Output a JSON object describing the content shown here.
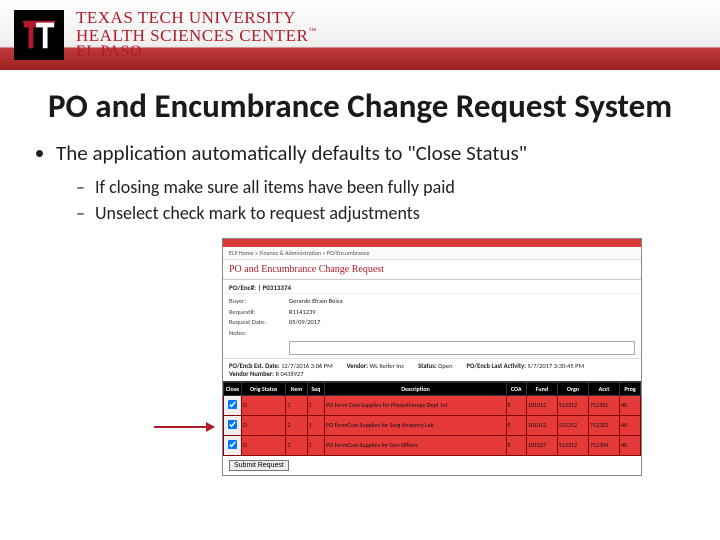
{
  "brand": {
    "line1": "TEXAS TECH UNIVERSITY",
    "line2": "HEALTH SCIENCES CENTER",
    "line3": "EL PASO"
  },
  "slide": {
    "title": "PO and Encumbrance Change Request System",
    "bullet": "The application automatically defaults to \"Close Status\"",
    "sub1": "If closing make sure all items have been fully paid",
    "sub2": "Unselect check mark to request adjustments"
  },
  "screenshot": {
    "breadcrumb": "ELP Home  »  Finance & Administration  »  PO/Encumbrance",
    "heading": "PO and Encumbrance Change Request",
    "po_label": "PO/Enc#:",
    "po_value": "| P0313374",
    "fields": {
      "buyer_label": "Buyer:",
      "buyer_value": "Gerardo Efrain Beisa",
      "requestor_label": "Request#:",
      "requestor_value": "R1141239",
      "reqdate_label": "Request Date:",
      "reqdate_value": "05/09/2017",
      "notes_label": "Notes:"
    },
    "meta": {
      "est_label": "PO/Encb Est. Date:",
      "est_value": "12/7/2016 3:06 PM",
      "last_label": "PO/Encb Last Activity:",
      "last_value": "5/7/2017 3:30:45 PM",
      "vendor_label": "Vendor:",
      "vendor_value": "WL Keifer Inc",
      "vnum_label": "Vendor Number:",
      "vnum_value": "R 0438927",
      "status_label": "Status:",
      "status_value": "Open"
    },
    "headers": {
      "h0": "Close",
      "h1": "Orig Status",
      "h2": "Item",
      "h3": "Seq",
      "h4": "Description",
      "h5": "COA",
      "h6": "Fund",
      "h7": "Orgn",
      "h8": "Acct",
      "h9": "Prog"
    },
    "rows": [
      {
        "status": "O",
        "item": "1",
        "seq": "1",
        "desc": "PO Form Cost-Supplies for Physiotherapy Dept 1st",
        "coa": "E",
        "fund": "101012",
        "orgn": "512312",
        "acct": "712301",
        "prog": "40"
      },
      {
        "status": "O",
        "item": "2",
        "seq": "1",
        "desc": "PO FormCost-Supplies for Surg Anatomy Lab",
        "coa": "E",
        "fund": "101012",
        "orgn": "512312",
        "acct": "712302",
        "prog": "40"
      },
      {
        "status": "O",
        "item": "3",
        "seq": "1",
        "desc": "PO FormCost-Supplies for Gen Offices",
        "coa": "E",
        "fund": "101027",
        "orgn": "512312",
        "acct": "712304",
        "prog": "40"
      }
    ],
    "submit": "Submit Request"
  }
}
